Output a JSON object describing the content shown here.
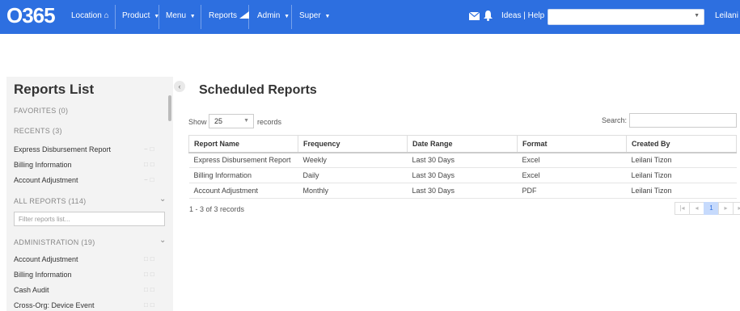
{
  "topbar": {
    "logo": "O365",
    "nav": [
      {
        "label": "Location",
        "icon": "home-icon"
      },
      {
        "label": "Product",
        "caret": "▼"
      },
      {
        "label": "Menu",
        "caret": "▼"
      },
      {
        "label": "Reports",
        "icon": "chart-icon"
      },
      {
        "label": "Admin",
        "caret": "▼"
      },
      {
        "label": "Super",
        "caret": "▼"
      }
    ],
    "ideas_help": "Ideas | Help",
    "user": "Leilani",
    "accent": "#2d6fe0"
  },
  "sidebar": {
    "title": "Reports List",
    "favorites": "FAVORITES (0)",
    "recents": "RECENTS (3)",
    "recent_items": [
      "Express Disbursement Report",
      "Billing Information",
      "Account Adjustment"
    ],
    "all_reports": "ALL REPORTS (114)",
    "filter_placeholder": "Filter reports list...",
    "administration": "ADMINISTRATION (19)",
    "admin_items": [
      "Account Adjustment",
      "Billing Information",
      "Cash Audit",
      "Cross-Org: Device Event"
    ]
  },
  "main": {
    "title": "Scheduled Reports",
    "show_label": "Show",
    "page_size": "25",
    "records_label": "records",
    "search_label": "Search:",
    "columns": [
      "Report Name",
      "Frequency",
      "Date Range",
      "Format",
      "Created By"
    ],
    "rows": [
      [
        "Express Disbursement Report",
        "Weekly",
        "Last 30 Days",
        "Excel",
        "Leilani Tizon"
      ],
      [
        "Billing Information",
        "Daily",
        "Last 30 Days",
        "Excel",
        "Leilani Tizon"
      ],
      [
        "Account Adjustment",
        "Monthly",
        "Last 30 Days",
        "PDF",
        "Leilani Tizon"
      ]
    ],
    "count_text": "1 - 3 of 3 records",
    "pager": {
      "first": "|◂",
      "prev": "◂",
      "current": "1",
      "next": "▸",
      "last": "▸|"
    }
  }
}
